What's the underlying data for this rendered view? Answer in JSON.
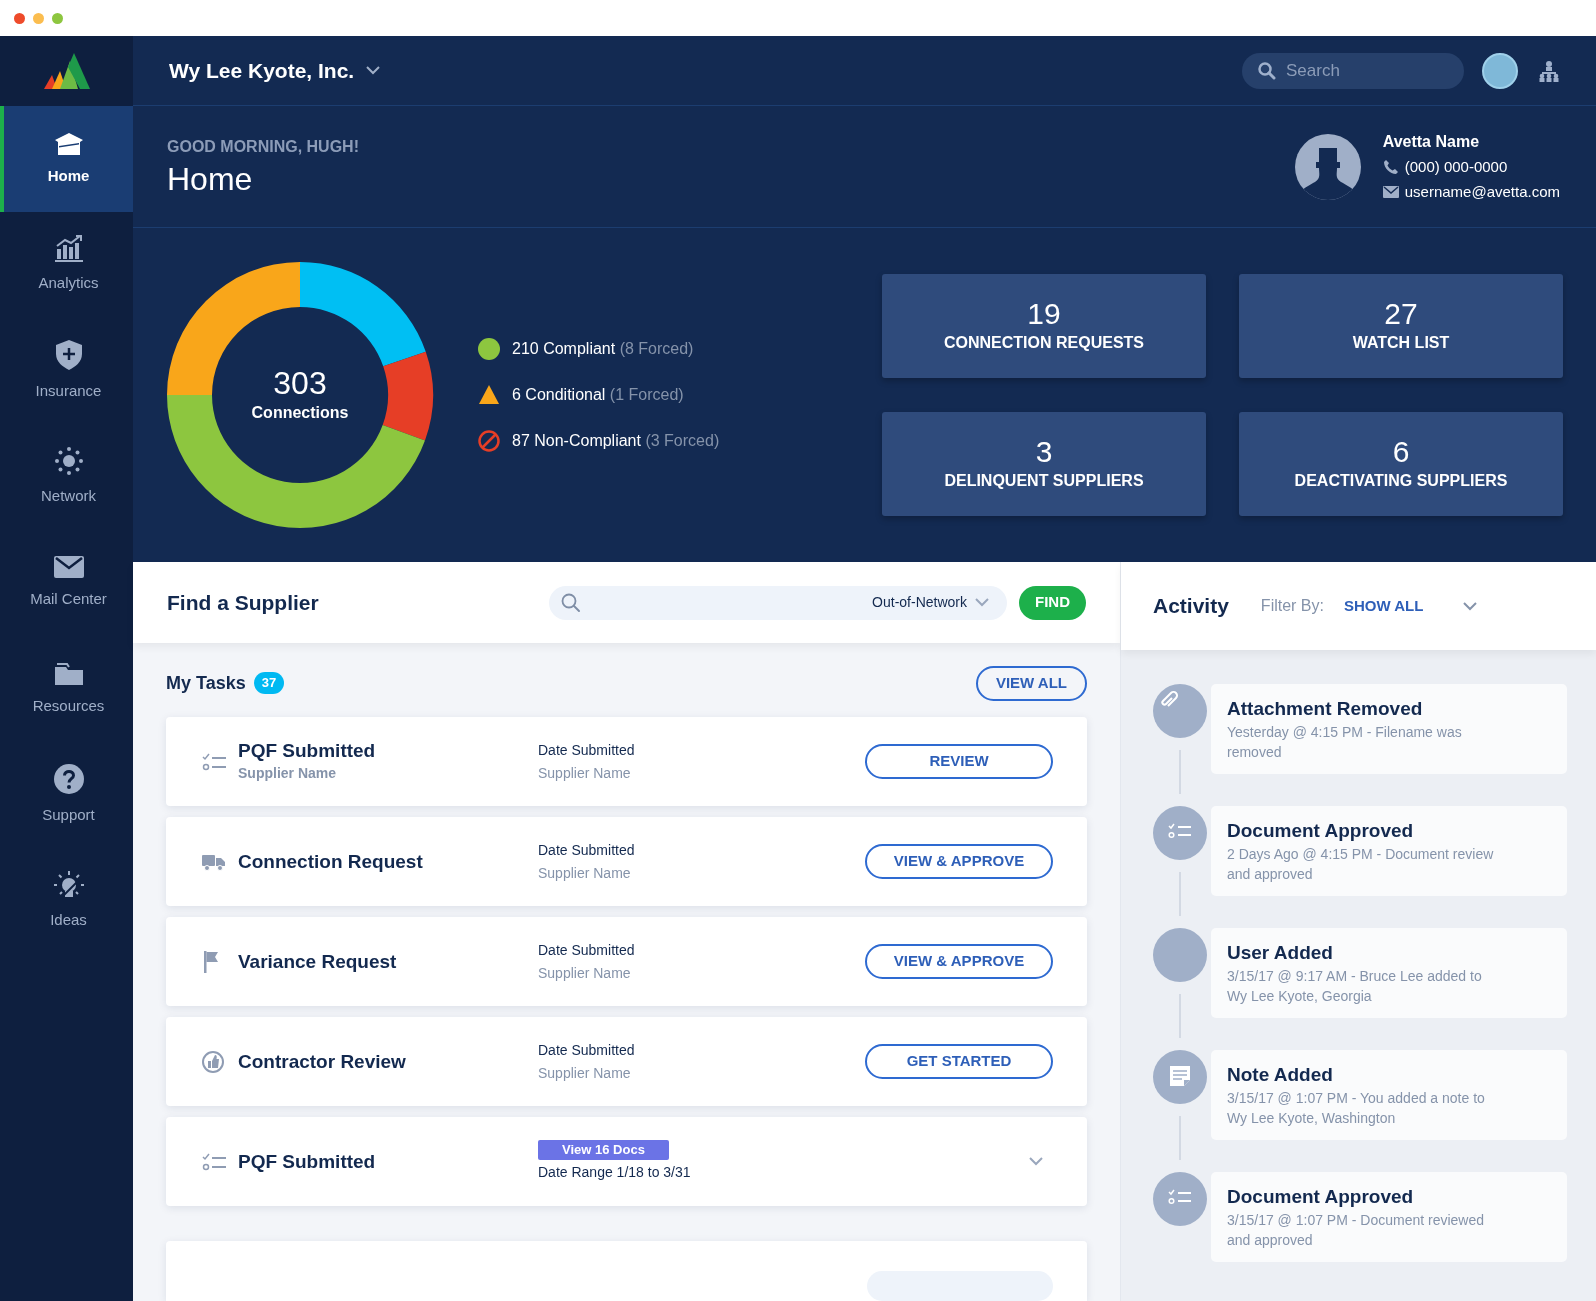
{
  "header": {
    "company": "Wy Lee Kyote, Inc.",
    "search": {
      "placeholder": "Search"
    }
  },
  "sidebar": {
    "items": [
      {
        "label": "Home",
        "selected": true
      },
      {
        "label": "Analytics",
        "selected": false
      },
      {
        "label": "Insurance",
        "selected": false
      },
      {
        "label": "Network",
        "selected": false
      },
      {
        "label": "Mail Center",
        "selected": false
      },
      {
        "label": "Resources",
        "selected": false
      },
      {
        "label": "Support",
        "selected": false
      },
      {
        "label": "Ideas",
        "selected": false
      }
    ]
  },
  "hero": {
    "greeting": "GOOD MORNING, HUGH!",
    "title": "Home",
    "contact": {
      "name": "Avetta Name",
      "phone": "(000) 000-0000",
      "email": "username@avetta.com"
    }
  },
  "summary": {
    "total": "303",
    "total_label": "Connections",
    "legend": [
      {
        "kind": "circle",
        "label": "210 Compliant",
        "note": "(8 Forced)",
        "color": "#8dc63f"
      },
      {
        "kind": "triangle",
        "label": "6 Conditional",
        "note": "(1 Forced)",
        "color": "#f9a61a"
      },
      {
        "kind": "blocked",
        "label": "87 Non-Compliant",
        "note": "(3 Forced)",
        "color": "#e63e26"
      }
    ],
    "stats": [
      {
        "value": "19",
        "label": "CONNECTION REQUESTS"
      },
      {
        "value": "27",
        "label": "WATCH LIST"
      },
      {
        "value": "3",
        "label": "DELINQUENT SUPPLIERS"
      },
      {
        "value": "6",
        "label": "DEACTIVATING SUPPLIERS"
      }
    ]
  },
  "find_supplier": {
    "title": "Find a Supplier",
    "filter": "Out-of-Network",
    "button": "FIND"
  },
  "tasks": {
    "title": "My Tasks",
    "count": "37",
    "view_all": "VIEW ALL",
    "items": [
      {
        "kind": "checklist",
        "title": "PQF Submitted",
        "subtitle": "Supplier Name",
        "date_label": "Date Submitted",
        "supplier": "Supplier Name",
        "action": "REVIEW"
      },
      {
        "kind": "truck",
        "title": "Connection Request",
        "date_label": "Date Submitted",
        "supplier": "Supplier Name",
        "action": "VIEW & APPROVE"
      },
      {
        "kind": "flag",
        "title": "Variance Request",
        "date_label": "Date Submitted",
        "supplier": "Supplier Name",
        "action": "VIEW & APPROVE"
      },
      {
        "kind": "thumb",
        "title": "Contractor Review",
        "date_label": "Date Submitted",
        "supplier": "Supplier Name",
        "action": "GET STARTED"
      },
      {
        "kind": "docs",
        "title": "PQF Submitted",
        "badge": "View 16 Docs",
        "date_range": "Date Range 1/18 to 3/31"
      }
    ]
  },
  "activity": {
    "title": "Activity",
    "filter_label": "Filter By:",
    "filter_value": "SHOW ALL",
    "items": [
      {
        "kind": "attachment",
        "title": "Attachment Removed",
        "detail": "Yesterday @ 4:15 PM - Filename was removed"
      },
      {
        "kind": "checklist",
        "title": "Document Approved",
        "detail": "2 Days Ago @ 4:15 PM - Document review and approved"
      },
      {
        "kind": "user",
        "title": "User Added",
        "detail": "3/15/17 @ 9:17 AM - Bruce Lee added to Wy Lee Kyote, Georgia"
      },
      {
        "kind": "note",
        "title": "Note Added",
        "detail": "3/15/17 @ 1:07 PM - You added a note to Wy Lee Kyote, Washington"
      },
      {
        "kind": "checklist",
        "title": "Document Approved",
        "detail": "3/15/17 @ 1:07 PM - Document reviewed and approved"
      }
    ]
  }
}
